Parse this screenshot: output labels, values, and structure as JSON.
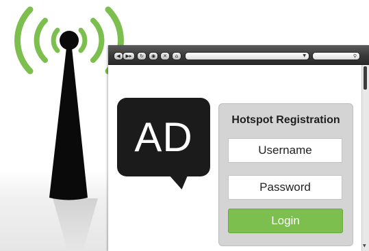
{
  "colors": {
    "wifi_waves": "#7cbf4e",
    "tower": "#0a0a0a",
    "ad_bubble": "#1b1b1b",
    "login_button": "#7cbf4e",
    "panel": "#d4d4d4"
  },
  "browser": {
    "toolbar": {
      "icons": [
        "back-icon",
        "forward-icon",
        "reload-icon",
        "stop-icon",
        "close-icon",
        "home-icon",
        "search-icon"
      ],
      "address_value": "",
      "search_value": ""
    }
  },
  "ad": {
    "text": "AD"
  },
  "registration": {
    "title": "Hotspot Registration",
    "username_placeholder": "Username",
    "password_placeholder": "Password",
    "login_label": "Login"
  }
}
